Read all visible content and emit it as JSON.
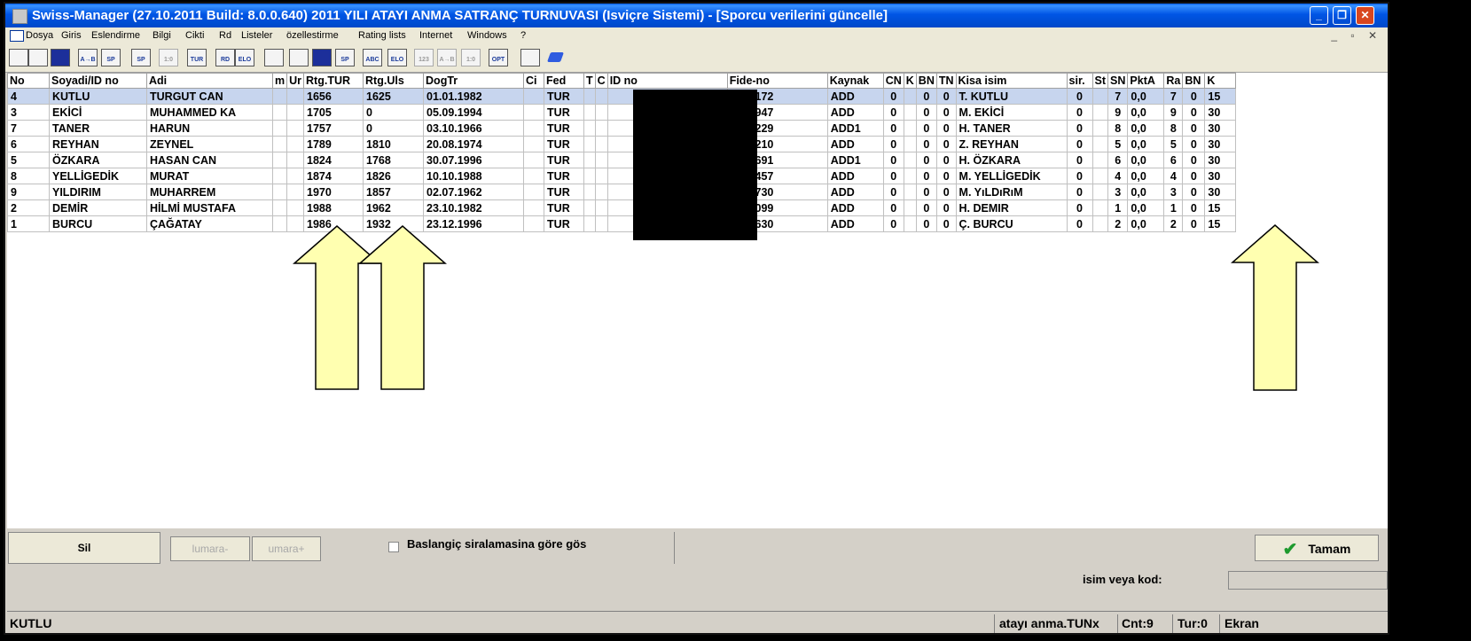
{
  "window": {
    "title": "Swiss-Manager (27.10.2011 Build: 8.0.0.640)  2011 YILI ATAYI ANMA SATRANÇ TURNUVASI     (Isviçre Sistemi) - [Sporcu verilerini güncelle]"
  },
  "menu": {
    "items": [
      "Dosya",
      "Giris",
      "Eslendirme",
      "Bilgi",
      "Cikti",
      "Rd",
      "Listeler",
      "özellestirme",
      "Rating lists",
      "Internet",
      "Windows",
      "?"
    ]
  },
  "toolbar": {
    "icons": [
      "new-file-icon",
      "open-folder-icon",
      "save-icon",
      "sort-az-icon",
      "sp-icon",
      "sp-icon-2",
      "one-zero-icon",
      "tur-icon",
      "rd-icon",
      "elo-icon",
      "screen-icon",
      "print-icon",
      "save-icon-2",
      "sp-icon-3",
      "sort-abc-icon",
      "sort-elo-icon",
      "sort-123-icon",
      "sort-ab-icon",
      "one-zero-icon-2",
      "opt-icon",
      "help-icon",
      "book-icon"
    ],
    "labels": [
      "",
      "",
      "",
      "A→B",
      "SP",
      "SP",
      "1:0",
      "TUR",
      "RD",
      "ELO",
      "",
      "",
      "",
      "SP",
      "ABC",
      "ELO",
      "123",
      "A→B",
      "1:0",
      "OPT",
      "",
      ""
    ]
  },
  "table": {
    "columns": [
      "No",
      "Soyadi/ID no",
      "Adi",
      "m",
      "Ur",
      "Rtg.TUR",
      "Rtg.Uls",
      "DogTr",
      "Ci",
      "Fed",
      "T",
      "C",
      "ID no",
      "Fide-no",
      "Kaynak",
      "CN",
      "K",
      "BN",
      "TN",
      "Kisa isim",
      "sir.",
      "St",
      "SN",
      "PktA",
      "Ra",
      "BN",
      "K"
    ],
    "rows": [
      [
        "4",
        "KUTLU",
        "TURGUT CAN",
        "",
        "",
        "1656",
        "1625",
        "01.01.1982",
        "",
        "TUR",
        "",
        "",
        "",
        "6340172",
        "ADD",
        "0",
        "",
        "0",
        "0",
        "T. KUTLU",
        "0",
        "",
        "7",
        "0,0",
        "7",
        "0",
        "15"
      ],
      [
        "3",
        "EKİCİ",
        "MUHAMMED KA",
        "",
        "",
        "1705",
        "0",
        "05.09.1994",
        "",
        "TUR",
        "",
        "",
        "",
        "6319947",
        "ADD",
        "0",
        "",
        "0",
        "0",
        "M. EKİCİ",
        "0",
        "",
        "9",
        "0,0",
        "9",
        "0",
        "30"
      ],
      [
        "7",
        "TANER",
        "HARUN",
        "",
        "",
        "1757",
        "0",
        "03.10.1966",
        "",
        "TUR",
        "",
        "",
        "",
        "6340229",
        "ADD1",
        "0",
        "",
        "0",
        "0",
        "H. TANER",
        "0",
        "",
        "8",
        "0,0",
        "8",
        "0",
        "30"
      ],
      [
        "6",
        "REYHAN",
        "ZEYNEL",
        "",
        "",
        "1789",
        "1810",
        "20.08.1974",
        "",
        "TUR",
        "",
        "",
        "",
        "6340210",
        "ADD",
        "0",
        "",
        "0",
        "0",
        "Z. REYHAN",
        "0",
        "",
        "5",
        "0,0",
        "5",
        "0",
        "30"
      ],
      [
        "5",
        "ÖZKARA",
        "HASAN CAN",
        "",
        "",
        "1824",
        "1768",
        "30.07.1996",
        "",
        "TUR",
        "",
        "",
        "",
        "6364691",
        "ADD1",
        "0",
        "",
        "0",
        "0",
        "H. ÖZKARA",
        "0",
        "",
        "6",
        "0,0",
        "6",
        "0",
        "30"
      ],
      [
        "8",
        "YELLİGEDİK",
        "MURAT",
        "",
        "",
        "1874",
        "1826",
        "10.10.1988",
        "",
        "TUR",
        "",
        "",
        "",
        "6366457",
        "ADD",
        "0",
        "",
        "0",
        "0",
        "M. YELLİGEDİK",
        "0",
        "",
        "4",
        "0,0",
        "4",
        "0",
        "30"
      ],
      [
        "9",
        "YILDIRIM",
        "MUHARREM",
        "",
        "",
        "1970",
        "1857",
        "02.07.1962",
        "",
        "TUR",
        "",
        "",
        "",
        "6364730",
        "ADD",
        "0",
        "",
        "0",
        "0",
        "M. YıLDıRıM",
        "0",
        "",
        "3",
        "0,0",
        "3",
        "0",
        "30"
      ],
      [
        "2",
        "DEMİR",
        "HİLMİ MUSTAFA",
        "",
        "",
        "1988",
        "1962",
        "23.10.1982",
        "",
        "TUR",
        "",
        "",
        "",
        "6303099",
        "ADD",
        "0",
        "",
        "0",
        "0",
        "H. DEMIR",
        "0",
        "",
        "1",
        "0,0",
        "1",
        "0",
        "15"
      ],
      [
        "1",
        "BURCU",
        "ÇAĞATAY",
        "",
        "",
        "1986",
        "1932",
        "23.12.1996",
        "",
        "TUR",
        "",
        "",
        "",
        "6310630",
        "ADD",
        "0",
        "",
        "0",
        "0",
        "Ç. BURCU",
        "0",
        "",
        "2",
        "0,0",
        "2",
        "0",
        "15"
      ]
    ]
  },
  "buttons": {
    "delete": "Sil",
    "num_minus": "lumara-",
    "num_plus": "umara+",
    "checkbox_label": "Baslangiç siralamasina göre gös",
    "ok": "Tamam"
  },
  "search": {
    "label": "isim veya kod:",
    "value": ""
  },
  "status": {
    "name": "KUTLU",
    "file": "atayı anma.TUNx",
    "count": "Cnt:9",
    "round": "Tur:0",
    "mode": "Ekran"
  },
  "colors": {
    "title": "#0055e5",
    "selected_row": "#c7d5ee",
    "arrow_fill": "#ffffb0"
  }
}
